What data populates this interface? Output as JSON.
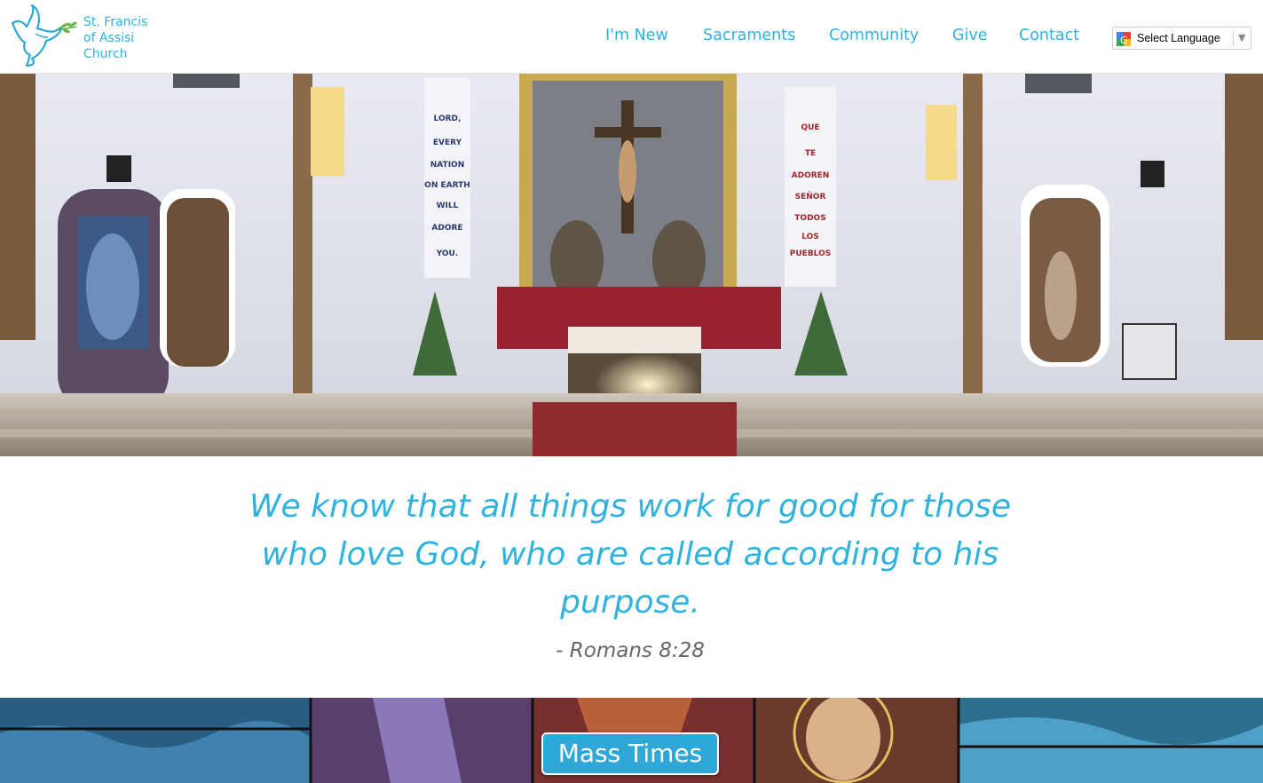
{
  "site": {
    "name_lines": [
      "St. Francis",
      "of Assisi",
      "Church"
    ]
  },
  "nav": {
    "items": [
      {
        "label": "I'm New"
      },
      {
        "label": "Sacraments"
      },
      {
        "label": "Community"
      },
      {
        "label": "Give"
      },
      {
        "label": "Contact"
      }
    ]
  },
  "language": {
    "label": "Select Language",
    "arrow": "▼"
  },
  "hero": {
    "banner_left": [
      "LORD,",
      "EVERY",
      "NATION",
      "ON EARTH",
      "WILL",
      "ADORE",
      "YOU."
    ],
    "banner_right": [
      "QUE",
      "TE",
      "ADOREN",
      "SEÑOR",
      "TODOS",
      "LOS",
      "PUEBLOS"
    ]
  },
  "quote": {
    "text": "We know that all things work for good for those who love God, who are called according to his purpose.",
    "citation": "- Romans 8:28"
  },
  "cta": {
    "mass_times_label": "Mass Times"
  },
  "colors": {
    "accent": "#2fb3de",
    "button": "#2fa8d8",
    "citation": "#666666"
  }
}
